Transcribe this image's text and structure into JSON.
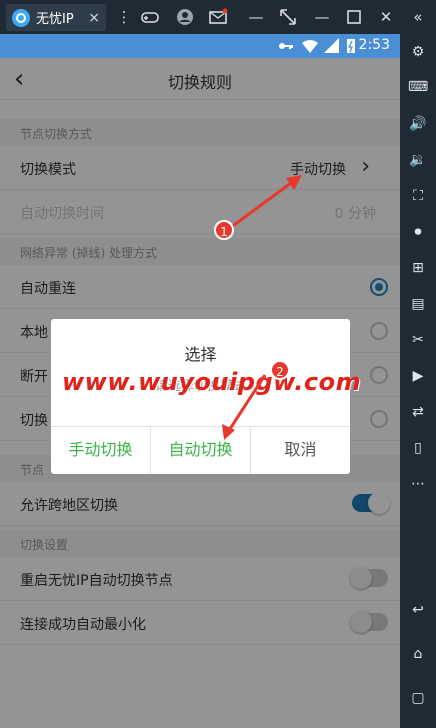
{
  "emulator": {
    "tab_title": "无忧IP",
    "tab_close": "×",
    "toolbar_icons": [
      "menu-icon",
      "gamepad-icon",
      "user-icon",
      "mail-icon",
      "expand-icon",
      "minimize-icon",
      "maximize-icon",
      "close-icon",
      "back-double-icon"
    ],
    "sidebar_icons": [
      "settings-icon",
      "keyboard-icon",
      "volume-up-icon",
      "volume-down-icon",
      "screenshot-icon",
      "record-icon",
      "add-app-icon",
      "apk-icon",
      "scissors-icon",
      "video-icon",
      "sync-icon",
      "phone-shake-icon",
      "more-icon"
    ],
    "navkeys": [
      "back-icon",
      "home-icon",
      "recent-apps-icon"
    ]
  },
  "statusbar": {
    "time": "2:53"
  },
  "app": {
    "title": "切换规则",
    "sections": [
      {
        "header": "节点切换方式",
        "rows": [
          {
            "label": "切换模式",
            "value": "手动切换",
            "dim": false
          },
          {
            "label": "自动切换时间",
            "value": "0 分钟",
            "dim": true
          }
        ]
      },
      {
        "header": "网络异常 (掉线) 处理方式",
        "rows": [
          {
            "label": "自动重连",
            "selected": true
          },
          {
            "label": "本地",
            "selected": false
          },
          {
            "label": "断开",
            "selected": false
          },
          {
            "label": "切换",
            "selected": false
          }
        ]
      },
      {
        "header": "节点",
        "rows": [
          {
            "label": "允许跨地区切换",
            "on": true
          }
        ]
      },
      {
        "header": "切换设置",
        "rows": [
          {
            "label": "重启无忧IP自动切换节点",
            "on": false
          },
          {
            "label": "连接成功自动最小化",
            "on": false
          }
        ]
      }
    ]
  },
  "dialog": {
    "title": "选择",
    "message": "请选择切换模式",
    "buttons": [
      "手动切换",
      "自动切换",
      "取消"
    ]
  },
  "watermark": "www.wuyouipgw.com",
  "markers": [
    "1",
    "2"
  ],
  "colors": {
    "accent": "#1e88c8",
    "status_bar": "#4a8fd6",
    "dialog_green": "#3cb34a",
    "marker_red": "#e8372c"
  }
}
